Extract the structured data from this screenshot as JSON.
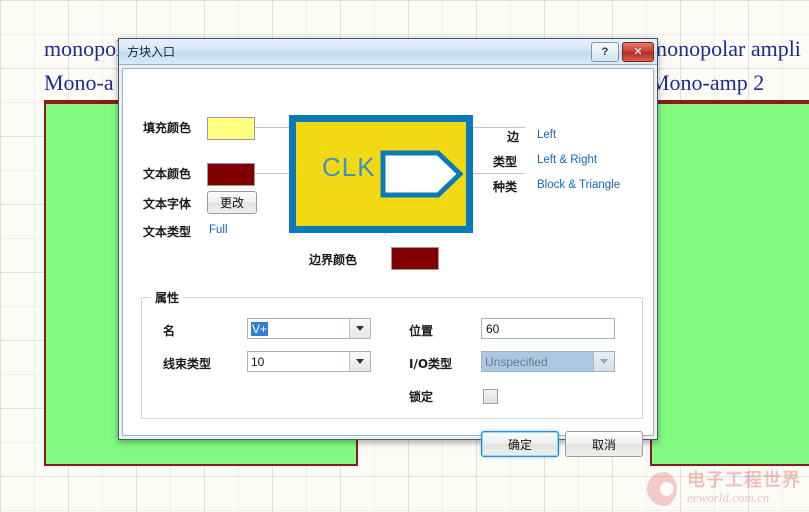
{
  "background": {
    "line1": "monopolar amplifier",
    "line2_left": "Mono-a",
    "line2_right": "Mono-amp 2",
    "line1_right": "monopolar ampli"
  },
  "watermark": {
    "cn": "电子工程世界",
    "en": "eeworld.com.cn"
  },
  "dialog": {
    "title": "方块入口",
    "help_label": "?",
    "close_label": "✕",
    "preview": {
      "text": "CLK",
      "fill_color": "#f2d913",
      "border_color": "#0b7ab8",
      "text_color": "#3f93c4"
    },
    "left_fields": [
      {
        "label": "填充颜色",
        "kind": "swatch",
        "value": "#ffff80"
      },
      {
        "label": "文本颜色",
        "kind": "swatch",
        "value": "#800000"
      },
      {
        "label": "文本字体",
        "kind": "button",
        "value": "更改"
      },
      {
        "label": "文本类型",
        "kind": "link",
        "value": "Full"
      }
    ],
    "border_color_field": {
      "label": "边界颜色",
      "value": "#800000"
    },
    "right_fields": [
      {
        "label": "边",
        "value": "Left"
      },
      {
        "label": "类型",
        "value": "Left & Right"
      },
      {
        "label": "种类",
        "value": "Block & Triangle"
      }
    ],
    "properties": {
      "group_title": "属性",
      "name": {
        "label": "名",
        "value": "V+"
      },
      "harness_type": {
        "label": "线束类型",
        "value": "10"
      },
      "position": {
        "label": "位置",
        "value": "60"
      },
      "io_type": {
        "label": "I/O类型",
        "value": "Unspecified"
      },
      "lock": {
        "label": "锁定",
        "checked": false
      }
    },
    "ok_label": "确定",
    "cancel_label": "取消"
  }
}
